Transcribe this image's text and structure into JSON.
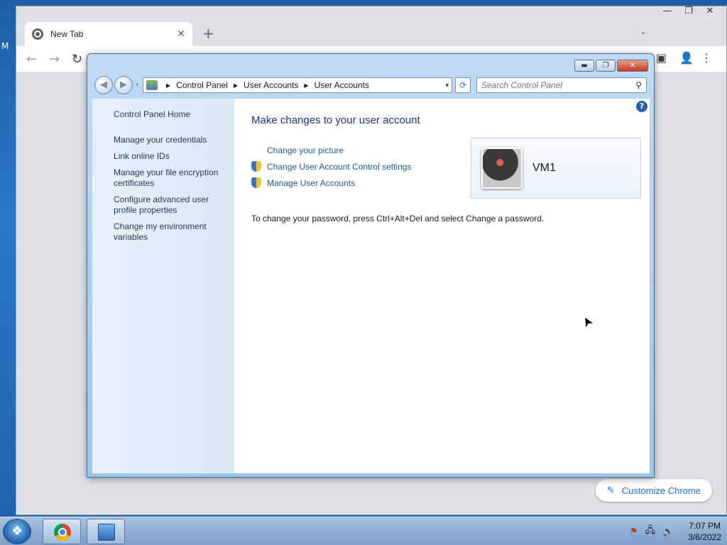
{
  "desktop": {
    "label": "M"
  },
  "chrome": {
    "tab_title": "New Tab",
    "tab_close": "✕",
    "new_tab": "+",
    "tab_dropdown": "⌄",
    "window_controls": [
      "—",
      "❐",
      "✕"
    ],
    "nav": {
      "back": "←",
      "forward": "→",
      "reload": "↻"
    },
    "toolbar_right": [
      "▣",
      "👤",
      "⋮"
    ],
    "customize_label": "Customize Chrome",
    "customize_icon": "✎"
  },
  "control_panel": {
    "window_controls": {
      "minimize": "▬",
      "maximize": "❐",
      "close": "✕"
    },
    "nav": {
      "back": "◀",
      "forward": "▶",
      "dropdown": "▾"
    },
    "breadcrumb": [
      "Control Panel",
      "User Accounts",
      "User Accounts"
    ],
    "breadcrumb_sep": "▶",
    "address_dropdown": "▾",
    "refresh": "⟳",
    "search_placeholder": "Search Control Panel",
    "search_icon": "⚲",
    "help": "?",
    "left_pane": {
      "home": "Control Panel Home",
      "tasks": [
        "Manage your credentials",
        "Link online IDs",
        "Manage your file encryption certificates",
        "Configure advanced user profile properties",
        "Change my environment variables"
      ]
    },
    "main": {
      "heading": "Make changes to your user account",
      "links": [
        {
          "label": "Change your picture",
          "shield": false
        },
        {
          "label": "Change User Account Control settings",
          "shield": true
        },
        {
          "label": "Manage User Accounts",
          "shield": true
        }
      ],
      "note": "To change your password, press Ctrl+Alt+Del and select Change a password."
    },
    "account": {
      "name": "VM1"
    }
  },
  "taskbar": {
    "tray_icons": [
      "⚑",
      "🖧",
      "🔊"
    ],
    "time": "7:07 PM",
    "date": "3/6/2022"
  },
  "cursor": "➤"
}
